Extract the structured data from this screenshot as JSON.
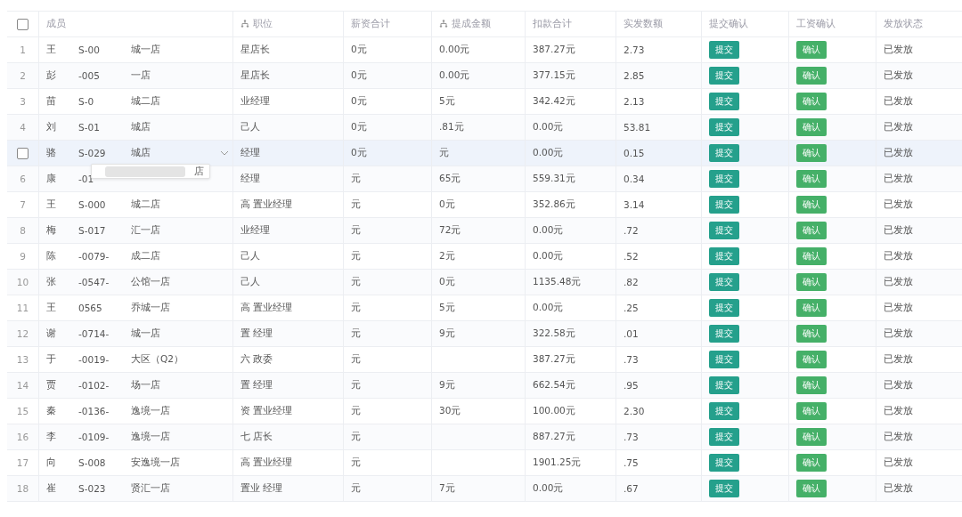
{
  "table": {
    "select_all": {
      "checked": false
    },
    "columns": [
      {
        "label": "成员"
      },
      {
        "label": "职位",
        "icon": true
      },
      {
        "label": "薪资合计"
      },
      {
        "label": "提成金额",
        "icon": true
      },
      {
        "label": "扣款合计"
      },
      {
        "label": "实发数额"
      },
      {
        "label": "提交确认"
      },
      {
        "label": "工资确认"
      },
      {
        "label": "发放状态"
      }
    ],
    "rows": [
      {
        "index": "1",
        "hovered": false,
        "name": "王",
        "id": "S-00",
        "store": "城一店",
        "position": "星店长",
        "salary": "0元",
        "commission": "0.00元",
        "deduction": "387.27元",
        "net": "2.73",
        "submit": "提交",
        "confirm": "确认",
        "status": "已发放"
      },
      {
        "index": "2",
        "hovered": false,
        "name": "彭",
        "id": "-005",
        "store": "一店",
        "position": "星店长",
        "salary": "0元",
        "commission": "0.00元",
        "deduction": "377.15元",
        "net": "2.85",
        "submit": "提交",
        "confirm": "确认",
        "status": "已发放"
      },
      {
        "index": "3",
        "hovered": false,
        "name": "苗",
        "id": "S-0",
        "store": "城二店",
        "position": "业经理",
        "salary": "0元",
        "commission": "5元",
        "deduction": "342.42元",
        "net": "2.13",
        "submit": "提交",
        "confirm": "确认",
        "status": "已发放"
      },
      {
        "index": "4",
        "hovered": false,
        "name": "刘",
        "id": "S-01",
        "store": "城店",
        "position": "己人",
        "salary": "0元",
        "commission": ".81元",
        "deduction": "0.00元",
        "net": "53.81",
        "submit": "提交",
        "confirm": "确认",
        "status": "已发放"
      },
      {
        "hovered": true,
        "name": "骆",
        "id": "S-029",
        "store": "城店",
        "position": "经理",
        "salary": "0元",
        "commission": "元",
        "deduction": "0.00元",
        "net": "0.15",
        "submit": "提交",
        "confirm": "确认",
        "status": "已发放",
        "popup": "店"
      },
      {
        "index": "6",
        "hovered": false,
        "name": "康",
        "id": "-01",
        "position": "经理",
        "salary": "元",
        "commission": "65元",
        "deduction": "559.31元",
        "net": "0.34",
        "submit": "提交",
        "confirm": "确认",
        "status": "已发放"
      },
      {
        "index": "7",
        "hovered": false,
        "name": "王",
        "id": "S-000",
        "store": "城二店",
        "position": "高 置业经理",
        "salary": "元",
        "commission": "0元",
        "deduction": "352.86元",
        "net": "3.14",
        "submit": "提交",
        "confirm": "确认",
        "status": "已发放"
      },
      {
        "index": "8",
        "hovered": false,
        "name": "梅",
        "id": "S-017",
        "store": "汇一店",
        "position": "业经理",
        "salary": "元",
        "commission": "72元",
        "deduction": "0.00元",
        "net": ".72",
        "submit": "提交",
        "confirm": "确认",
        "status": "已发放"
      },
      {
        "index": "9",
        "hovered": false,
        "name": "陈",
        "id": "-0079-",
        "store": "成二店",
        "position": "己人",
        "salary": "元",
        "commission": "2元",
        "deduction": "0.00元",
        "net": ".52",
        "submit": "提交",
        "confirm": "确认",
        "status": "已发放"
      },
      {
        "index": "10",
        "hovered": false,
        "name": "张",
        "id": "-0547-",
        "store": "公馆一店",
        "position": "己人",
        "salary": "元",
        "commission": "0元",
        "deduction": "1135.48元",
        "net": ".82",
        "submit": "提交",
        "confirm": "确认",
        "status": "已发放"
      },
      {
        "index": "11",
        "hovered": false,
        "name": "王",
        "id": "0565",
        "store": "乔城一店",
        "position": "高 置业经理",
        "salary": "元",
        "commission": "5元",
        "deduction": "0.00元",
        "net": ".25",
        "submit": "提交",
        "confirm": "确认",
        "status": "已发放"
      },
      {
        "index": "12",
        "hovered": false,
        "name": "谢",
        "id": "-0714-",
        "store": "城一店",
        "position": "置 经理",
        "salary": "元",
        "commission": "9元",
        "deduction": "322.58元",
        "net": ".01",
        "submit": "提交",
        "confirm": "确认",
        "status": "已发放"
      },
      {
        "index": "13",
        "hovered": false,
        "name": "于",
        "id": "-0019-",
        "store": "大区（Q2）",
        "position": "六 政委",
        "salary": "元",
        "deduction": "387.27元",
        "net": ".73",
        "submit": "提交",
        "confirm": "确认",
        "status": "已发放"
      },
      {
        "index": "14",
        "hovered": false,
        "name": "贾",
        "id": "-0102-",
        "store": "场一店",
        "position": "置 经理",
        "salary": "元",
        "commission": "9元",
        "deduction": "662.54元",
        "net": ".95",
        "submit": "提交",
        "confirm": "确认",
        "status": "已发放"
      },
      {
        "index": "15",
        "hovered": false,
        "name": "秦",
        "id": "-0136-",
        "store": "逸境一店",
        "position": "资 置业经理",
        "salary": "元",
        "commission": "30元",
        "deduction": "100.00元",
        "net": "2.30",
        "submit": "提交",
        "confirm": "确认",
        "status": "已发放"
      },
      {
        "index": "16",
        "hovered": false,
        "name": "李",
        "id": "-0109-",
        "store": "逸境一店",
        "position": "七 店长",
        "salary": "元",
        "deduction": "887.27元",
        "net": ".73",
        "submit": "提交",
        "confirm": "确认",
        "status": "已发放"
      },
      {
        "index": "17",
        "hovered": false,
        "name": "向",
        "id": "S-008",
        "store": "安逸境一店",
        "position": "高 置业经理",
        "salary": "元",
        "deduction": "1901.25元",
        "net": ".75",
        "submit": "提交",
        "confirm": "确认",
        "status": "已发放"
      },
      {
        "index": "18",
        "hovered": false,
        "name": "崔",
        "id": "S-023",
        "store": "贤汇一店",
        "position": "置业 经理",
        "salary": "元",
        "commission": "7元",
        "deduction": "0.00元",
        "net": ".67",
        "submit": "提交",
        "confirm": "确认",
        "status": "已发放"
      }
    ]
  }
}
